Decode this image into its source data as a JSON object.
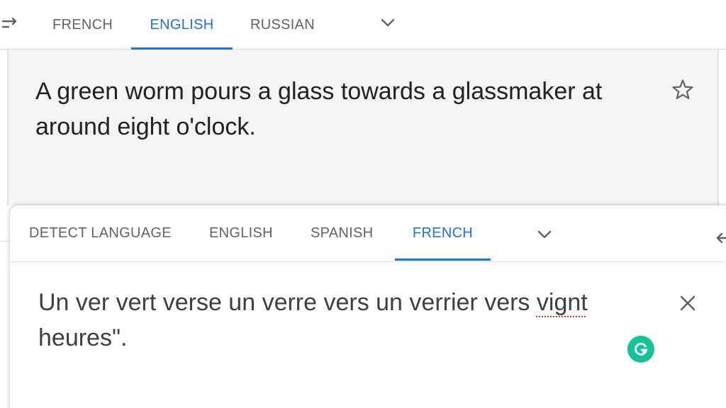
{
  "target_panel": {
    "tabs": [
      {
        "label": "FRENCH",
        "active": false
      },
      {
        "label": "ENGLISH",
        "active": true
      },
      {
        "label": "RUSSIAN",
        "active": false
      }
    ],
    "translation_text": "A green worm pours a glass towards a glassmaker at around eight o'clock.",
    "icons": {
      "swap": "swap-arrows-icon",
      "more": "chevron-down-icon",
      "save": "star-icon"
    }
  },
  "source_panel": {
    "tabs": [
      {
        "label": "DETECT LANGUAGE",
        "active": false
      },
      {
        "label": "ENGLISH",
        "active": false
      },
      {
        "label": "SPANISH",
        "active": false
      },
      {
        "label": "FRENCH",
        "active": true
      }
    ],
    "input_text_before": "Un ver vert verse un verre vers un verrier vers ",
    "input_text_misspelled": "vignt",
    "input_text_after": " heures\".",
    "icons": {
      "clear": "close-icon",
      "grammarly": "grammarly-icon",
      "swap": "swap-arrows-icon",
      "more": "chevron-down-icon"
    }
  },
  "colors": {
    "accent": "#1a73e8",
    "tab_inactive": "#5f6368",
    "output_background": "#f4f4f4",
    "spell_error": "#d93025",
    "grammarly": "#15c39a"
  }
}
